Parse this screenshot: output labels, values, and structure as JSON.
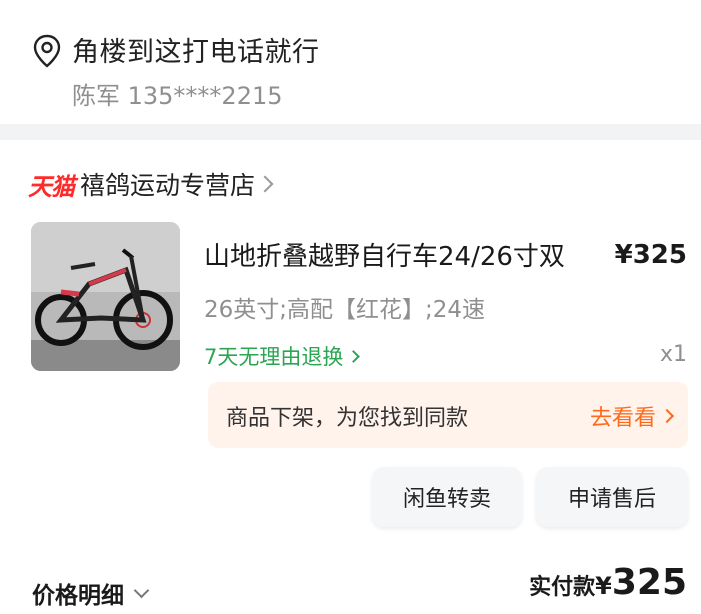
{
  "address": {
    "icon": "location-pin-icon",
    "line": "角楼到这打电话就行",
    "contact": "陈军 135****2215"
  },
  "shop": {
    "brand": "天猫",
    "brand_color": "#ff2a2a",
    "name": "禧鸽运动专营店"
  },
  "item": {
    "image": "mountain-bike-thumbnail",
    "title": "山地折叠越野自行车24/26寸双",
    "price": "¥325",
    "sku": "26英寸;高配【红花】;24速",
    "refund_policy": "7天无理由退换",
    "refund_color": "#2aa552",
    "quantity": "x1"
  },
  "delisted": {
    "message": "商品下架，为您找到同款",
    "action": "去看看",
    "accent": "#ff6a1a"
  },
  "actions": {
    "resell": "闲鱼转卖",
    "after_sale": "申请售后"
  },
  "footer": {
    "price_detail": "价格明细",
    "paid_label": "实付款",
    "paid_currency": "¥",
    "paid_amount": "325"
  }
}
